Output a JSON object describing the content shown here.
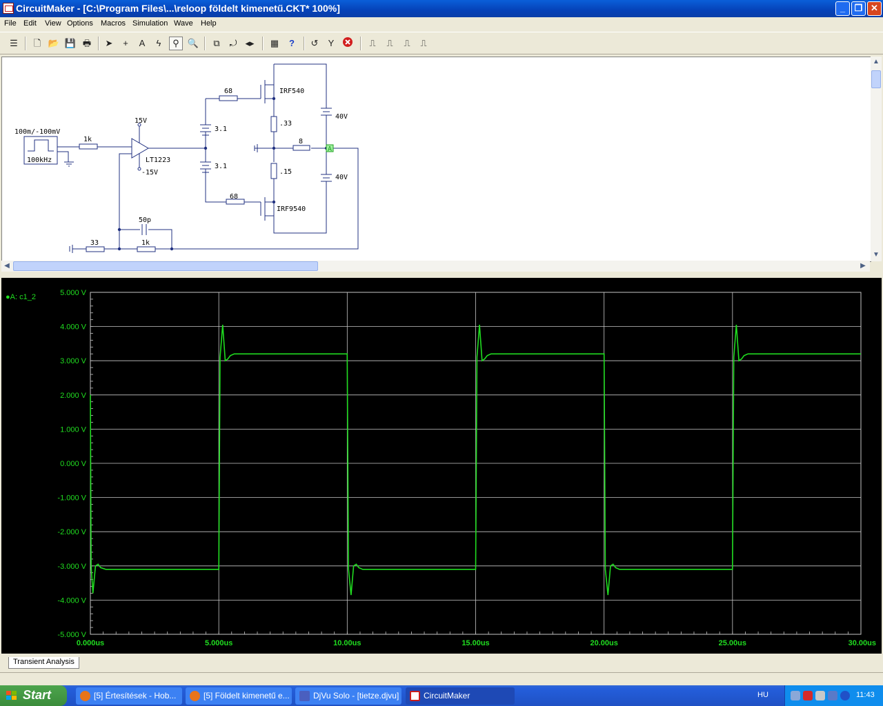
{
  "window": {
    "title": "CircuitMaker - [C:\\Program Files\\...\\reloop földelt kimenetű.CKT* 100%]",
    "controls": {
      "minimize": "_",
      "restore": "❐",
      "close": "✕"
    }
  },
  "menu": [
    "File",
    "Edit",
    "View",
    "Options",
    "Macros",
    "Simulation",
    "Wave",
    "Help"
  ],
  "toolbar": {
    "help_glyph": "?"
  },
  "schematic": {
    "labels": {
      "source_amplitude": "100m/-100mV",
      "source_freq": "100kHz",
      "r_in": "1k",
      "vpos": "15V",
      "vneg": "-15V",
      "opamp": "LT1223",
      "r_gate_top": "68",
      "r_gate_bot": "68",
      "bat_top": "3.1",
      "bat_bot": "3.1",
      "mosfet_top": "IRF540",
      "mosfet_bot": "IRF9540",
      "r_src_top": ".33",
      "r_src_bot": ".15",
      "r_load": "8",
      "supply_top": "40V",
      "supply_bot": "40V",
      "probe": "A",
      "c_fb": "50p",
      "r_fb": "1k",
      "r_gnd": "33"
    }
  },
  "scope": {
    "legend": "A: c1_2",
    "trace_color": "#20dd20",
    "y_ticks": [
      "5.000 V",
      "4.000 V",
      "3.000 V",
      "2.000 V",
      "1.000 V",
      "0.000 V",
      "-1.000 V",
      "-2.000 V",
      "-3.000 V",
      "-4.000 V",
      "-5.000 V"
    ],
    "x_ticks": [
      "0.000us",
      "5.000us",
      "10.00us",
      "15.00us",
      "20.00us",
      "25.00us",
      "30.00us"
    ]
  },
  "chart_data": {
    "type": "line",
    "title": "",
    "xlabel": "",
    "ylabel": "",
    "xlim": [
      0,
      30
    ],
    "ylim": [
      -5,
      5
    ],
    "series": [
      {
        "name": "A: c1_2",
        "x": [
          0.0,
          0.03,
          0.1,
          0.2,
          0.3,
          0.4,
          0.6,
          5.0,
          5.05,
          5.15,
          5.25,
          5.35,
          5.45,
          5.6,
          5.8,
          10.0,
          10.05,
          10.15,
          10.25,
          10.35,
          10.45,
          10.6,
          10.8,
          15.0,
          15.05,
          15.15,
          15.25,
          15.35,
          15.45,
          15.6,
          15.8,
          20.0,
          20.05,
          20.15,
          20.25,
          20.35,
          20.45,
          20.6,
          20.8,
          25.0,
          25.05,
          25.15,
          25.25,
          25.35,
          25.45,
          25.6,
          25.8,
          30.0
        ],
        "y": [
          2.0,
          -3.0,
          -3.8,
          -3.0,
          -2.95,
          -3.05,
          -3.1,
          -3.1,
          3.1,
          4.05,
          3.0,
          3.05,
          3.15,
          3.2,
          3.2,
          3.2,
          -3.1,
          -3.85,
          -3.0,
          -2.95,
          -3.05,
          -3.1,
          -3.1,
          -3.1,
          3.1,
          4.05,
          3.0,
          3.05,
          3.15,
          3.2,
          3.2,
          3.2,
          -3.1,
          -3.85,
          -3.0,
          -2.95,
          -3.05,
          -3.1,
          -3.1,
          -3.1,
          3.1,
          4.05,
          3.0,
          3.05,
          3.15,
          3.2,
          3.2,
          3.2
        ]
      }
    ],
    "grid": true,
    "legend": "top-left"
  },
  "tabs": {
    "transient": "Transient Analysis"
  },
  "taskbar": {
    "start": "Start",
    "buttons": [
      {
        "label": "[5] Értesítések - Hob...",
        "color": "#e8741a"
      },
      {
        "label": "[5] Földelt kimenetű e...",
        "color": "#e8741a"
      },
      {
        "label": "DjVu Solo - [tietze.djvu]",
        "color": "#4a5fbf"
      },
      {
        "label": "CircuitMaker",
        "color": "#c81e1e"
      }
    ],
    "lang": "HU",
    "clock": "11:43"
  }
}
